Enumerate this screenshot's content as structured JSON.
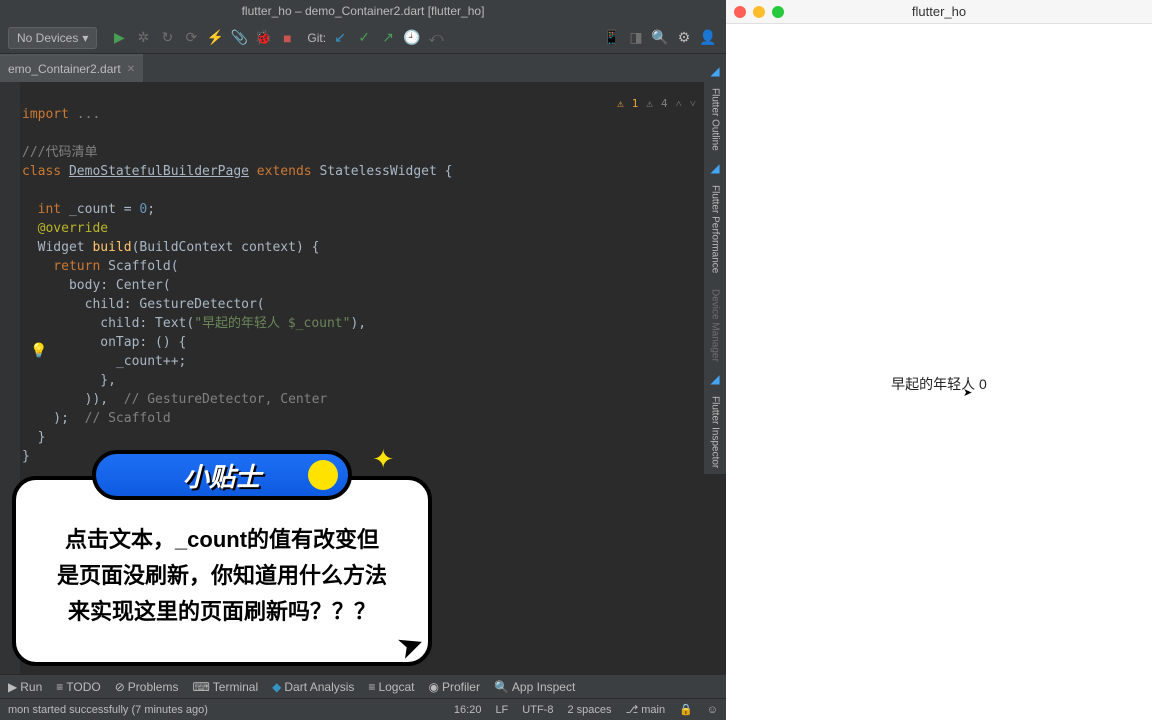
{
  "ide": {
    "title": "flutter_ho – demo_Container2.dart [flutter_ho]",
    "deviceDropdown": "No Devices",
    "gitLabel": "Git:",
    "tabs": [
      {
        "name": "emo_Container2.dart"
      }
    ],
    "warnings": {
      "yellow": "1",
      "gray": "4"
    },
    "code": {
      "l1a": "import",
      "l1b": " ...",
      "l2": "///代码清单",
      "l3a": "class ",
      "l3b": "DemoStatefulBuilderPage",
      "l3c": " extends ",
      "l3d": "StatelessWidget {",
      "l4a": "  int ",
      "l4b": "_count",
      "l4c": " = ",
      "l4d": "0",
      "l4e": ";",
      "l5": "  @override",
      "l6a": "  Widget ",
      "l6b": "build",
      "l6c": "(BuildContext context) {",
      "l7a": "    return ",
      "l7b": "Scaffold(",
      "l8": "      body: Center(",
      "l9": "        child: GestureDetector(",
      "l10a": "          child: Text(",
      "l10b": "\"早起的年轻人 $_count\"",
      "l10c": "),",
      "l11": "          onTap: () {",
      "l12": "            _count++;",
      "l13": "          },",
      "l14a": "        )),  ",
      "l14b": "// GestureDetector, Center",
      "l15a": "    );  ",
      "l15b": "// Scaffold",
      "l16": "  }",
      "l17": "}"
    },
    "rightTools": [
      "Flutter Outline",
      "Flutter Performance",
      "Device Manager",
      "Flutter Inspector"
    ],
    "bottomBar": {
      "run": "Run",
      "todo": "TODO",
      "problems": "Problems",
      "terminal": "Terminal",
      "dartAnalysis": "Dart Analysis",
      "logcat": "Logcat",
      "profiler": "Profiler",
      "appInspection": "App Inspect"
    },
    "statusBar": {
      "message": "mon started successfully (7 minutes ago)",
      "col": "16:20",
      "lf": "LF",
      "enc": "UTF-8",
      "indent": "2 spaces",
      "branch": "main"
    }
  },
  "simulator": {
    "title": "flutter_ho",
    "appText": "早起的年轻人 0"
  },
  "tip": {
    "pill": "小贴士",
    "line1": "点击文本，_count的值有改变但",
    "line2": "是页面没刷新，你知道用什么方法",
    "line3": "来实现这里的页面刷新吗？？？"
  }
}
